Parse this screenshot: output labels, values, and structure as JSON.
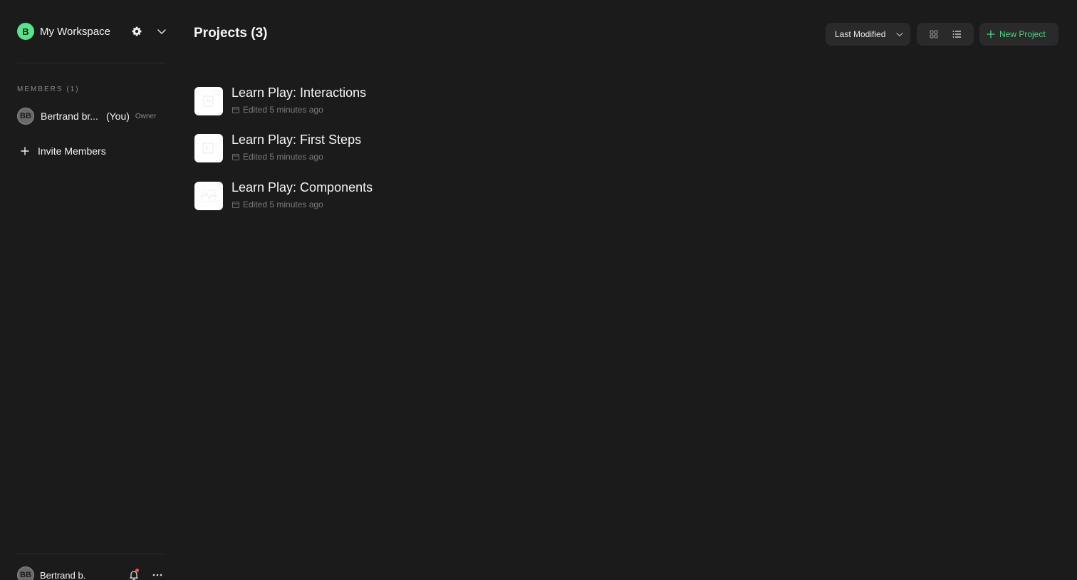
{
  "workspace": {
    "avatar_letter": "B",
    "name": "My Workspace",
    "settings_icon": "gear-icon",
    "menu_icon": "chevron-down-icon"
  },
  "members": {
    "title": "MEMBERS (1)",
    "list": [
      {
        "initials": "BB",
        "name": "Bertrand br...",
        "you": "(You)",
        "role": "Owner"
      }
    ],
    "invite_label": "Invite Members"
  },
  "footer": {
    "initials": "BB",
    "name": "Bertrand b.",
    "notification_icon": "bell-icon",
    "more_icon": "more-horizontal-icon"
  },
  "main": {
    "title": "Projects (3)",
    "sort_label": "Last Modified",
    "view_modes": [
      "grid-icon",
      "list-icon"
    ],
    "new_project_label": "New Project",
    "accent_color": "#3ddc84"
  },
  "projects": [
    {
      "title": "Learn Play: Interactions",
      "edited": "Edited 5 minutes ago"
    },
    {
      "title": "Learn Play: First Steps",
      "edited": "Edited 5 minutes ago"
    },
    {
      "title": "Learn Play: Components",
      "edited": "Edited 5 minutes ago"
    }
  ]
}
